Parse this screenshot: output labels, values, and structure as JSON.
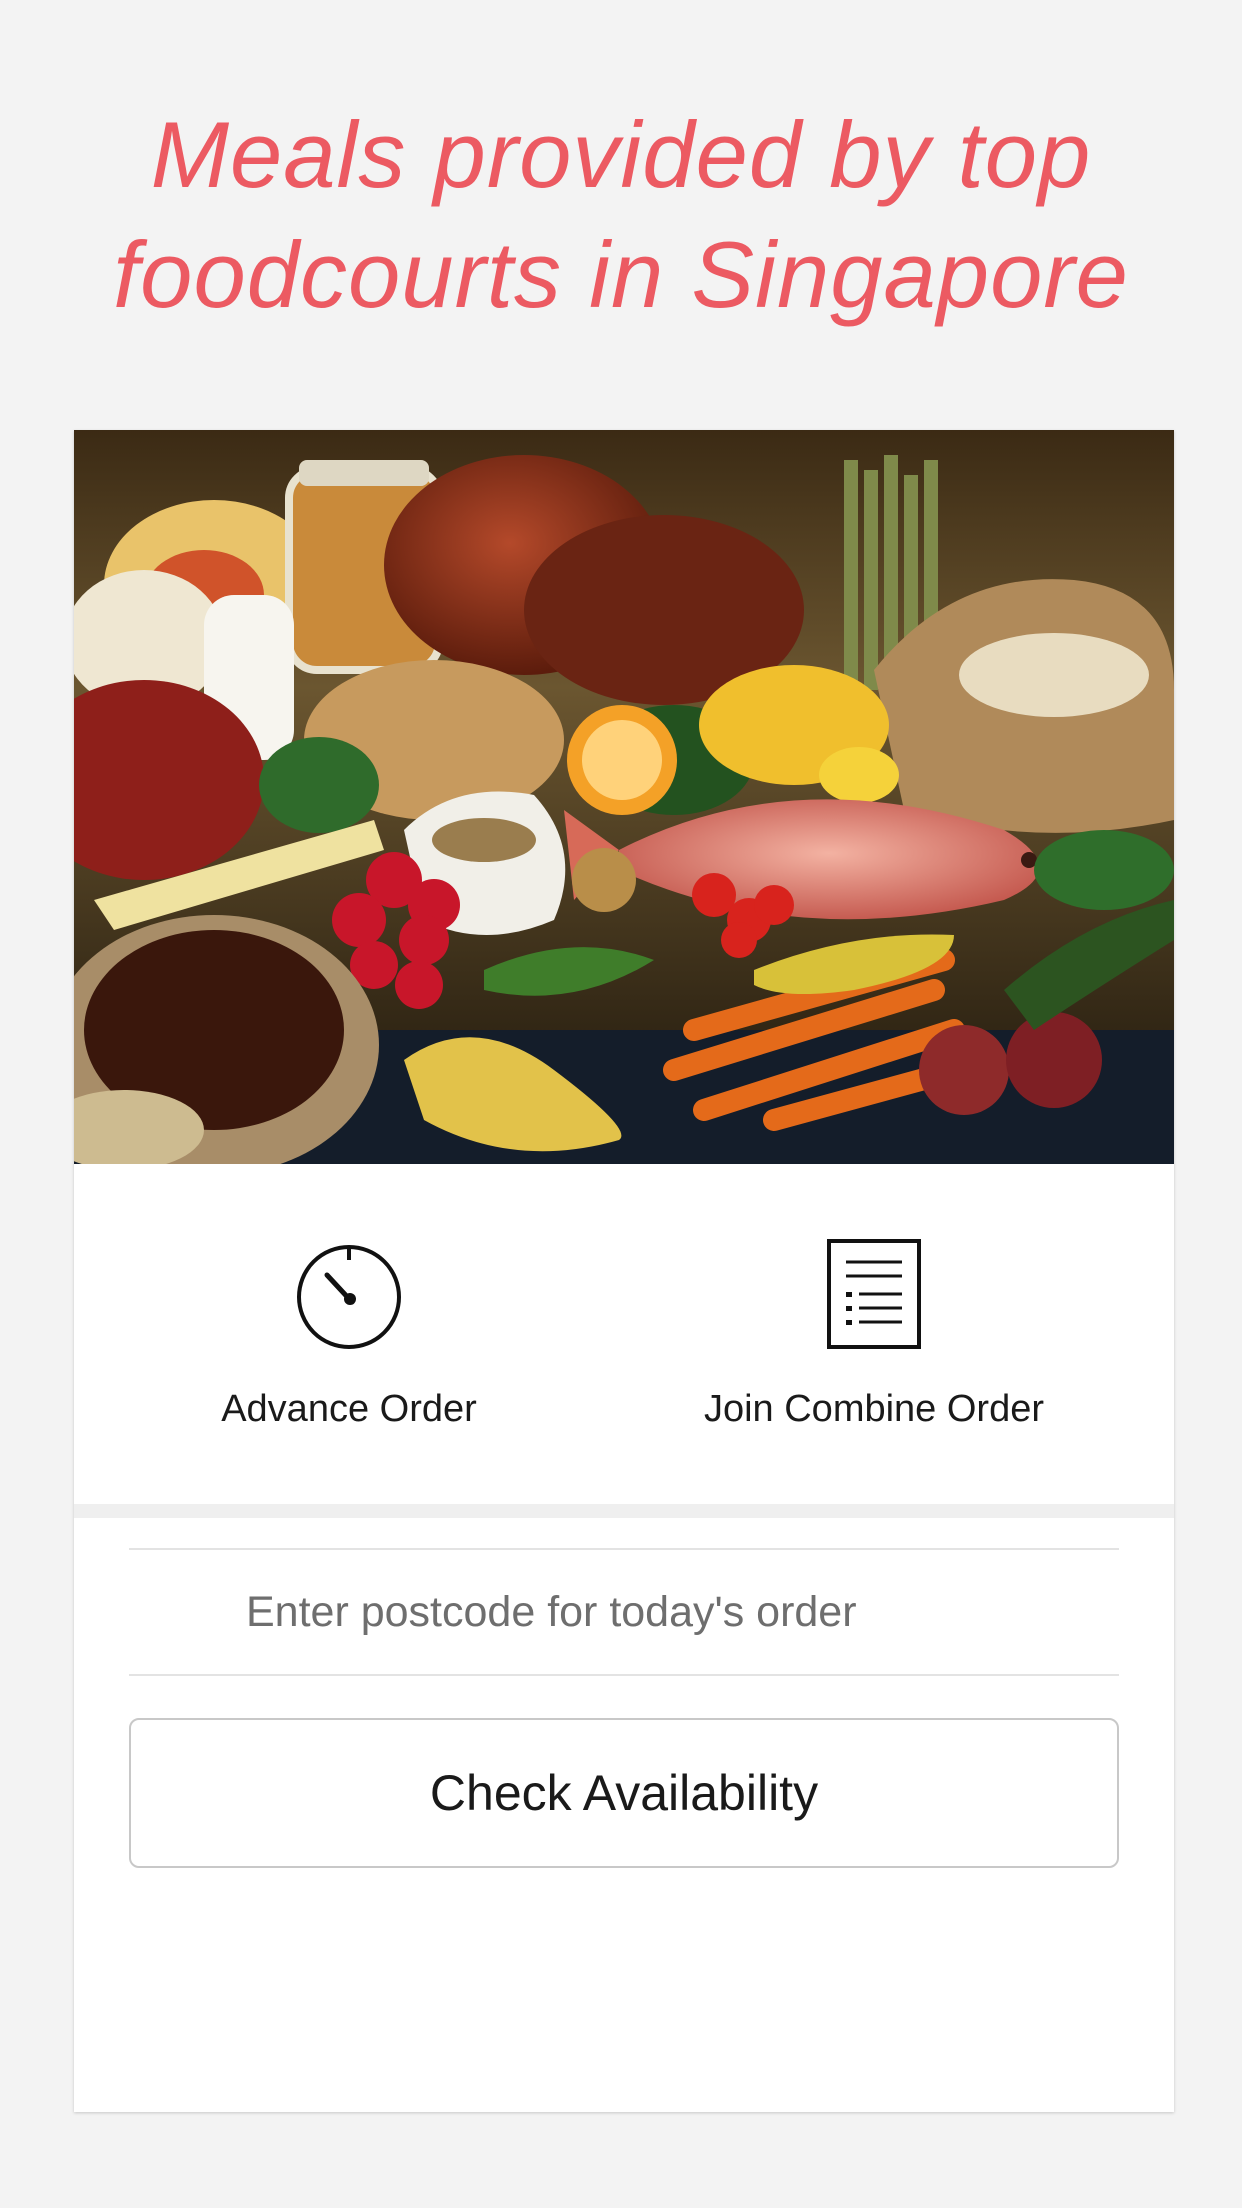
{
  "headline": {
    "line1": "Meals provided by top",
    "line2": "foodcourts in Singapore"
  },
  "colors": {
    "accent": "#ec5a62",
    "background": "#f3f3f3",
    "card": "#ffffff"
  },
  "options": [
    {
      "label": "Advance Order",
      "icon": "stopwatch-icon"
    },
    {
      "label": "Join Combine Order",
      "icon": "document-list-icon"
    }
  ],
  "postcode": {
    "placeholder": "Enter postcode for today's order",
    "value": ""
  },
  "check_button": {
    "label": "Check Availability"
  }
}
